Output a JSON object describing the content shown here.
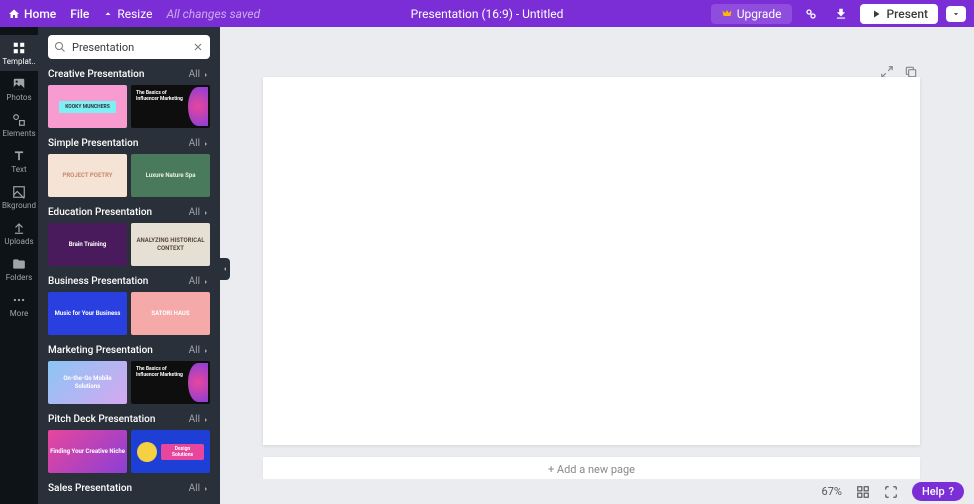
{
  "topbar": {
    "home": "Home",
    "file": "File",
    "resize": "Resize",
    "saved": "All changes saved",
    "title": "Presentation (16:9) - Untitled",
    "upgrade": "Upgrade",
    "present": "Present"
  },
  "sidebar": {
    "items": [
      {
        "label": "Templat..",
        "icon": "templates"
      },
      {
        "label": "Photos",
        "icon": "photos"
      },
      {
        "label": "Elements",
        "icon": "elements"
      },
      {
        "label": "Text",
        "icon": "text"
      },
      {
        "label": "Bkground",
        "icon": "background"
      },
      {
        "label": "Uploads",
        "icon": "uploads"
      },
      {
        "label": "Folders",
        "icon": "folders"
      },
      {
        "label": "More",
        "icon": "more"
      }
    ]
  },
  "search": {
    "value": "Presentation"
  },
  "categories": [
    {
      "title": "Creative Presentation",
      "all": "All",
      "thumbs": [
        {
          "bg": "linear-gradient(#f79bd0,#f79bd0)",
          "label": "KOOKY MUNCHERS",
          "accent": "#7df0f5"
        },
        {
          "bg": "#0e0e0e",
          "label": "The Basics of Influencer Marketing",
          "accent": "#e8469c"
        }
      ]
    },
    {
      "title": "Simple Presentation",
      "all": "All",
      "thumbs": [
        {
          "bg": "#f5e3d5",
          "label": "PROJECT POETRY",
          "color": "#c98b6a"
        },
        {
          "bg": "#4a7a5c",
          "label": "Luxure Nature Spa",
          "color": "#e8f0e4"
        }
      ]
    },
    {
      "title": "Education Presentation",
      "all": "All",
      "thumbs": [
        {
          "bg": "#4a1b5c",
          "label": "Brain Training",
          "color": "#fff"
        },
        {
          "bg": "#e6dfd3",
          "label": "ANALYZING HISTORICAL CONTEXT",
          "color": "#5a4a3a"
        }
      ]
    },
    {
      "title": "Business Presentation",
      "all": "All",
      "thumbs": [
        {
          "bg": "#2a3fe0",
          "label": "Music for Your Business",
          "color": "#fff"
        },
        {
          "bg": "#f5a9a9",
          "label": "SATORI HAUS",
          "color": "#fff"
        }
      ]
    },
    {
      "title": "Marketing Presentation",
      "all": "All",
      "thumbs": [
        {
          "bg": "linear-gradient(135deg,#8bc5f5,#d5a8f0)",
          "label": "On-the-Go Mobile Solutions",
          "color": "#fff"
        },
        {
          "bg": "#0e0e0e",
          "label": "The Basics of Influencer Marketing",
          "accent": "#e8469c"
        }
      ]
    },
    {
      "title": "Pitch Deck Presentation",
      "all": "All",
      "thumbs": [
        {
          "bg": "linear-gradient(135deg,#e8469c,#8b3fd6)",
          "label": "Finding Your Creative Niche",
          "color": "#fff"
        },
        {
          "bg": "#1e3fd6",
          "label": "Design Solutions",
          "accent": "#f5d040",
          "color": "#fff"
        }
      ]
    },
    {
      "title": "Sales Presentation",
      "all": "All",
      "thumbs": []
    }
  ],
  "canvas": {
    "add_page": "+ Add a new page"
  },
  "status": {
    "zoom": "67%",
    "help": "Help"
  }
}
